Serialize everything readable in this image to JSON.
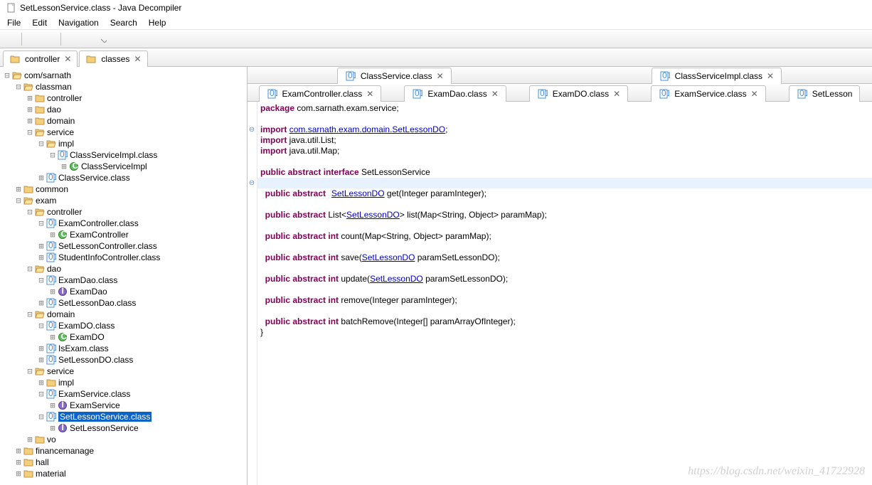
{
  "window": {
    "title": "SetLessonService.class - Java Decompiler"
  },
  "menu": {
    "file": "File",
    "edit": "Edit",
    "navigation": "Navigation",
    "search": "Search",
    "help": "Help"
  },
  "folderTabs": [
    {
      "label": "controller",
      "close": "✕"
    },
    {
      "label": "classes",
      "close": "✕"
    }
  ],
  "tree": {
    "root": {
      "l": "com/sarnath"
    },
    "n1": {
      "l": "classman"
    },
    "n1a": {
      "l": "controller"
    },
    "n1b": {
      "l": "dao"
    },
    "n1c": {
      "l": "domain"
    },
    "n1d": {
      "l": "service"
    },
    "n1d1": {
      "l": "impl"
    },
    "n1d1a": {
      "l": "ClassServiceImpl.class"
    },
    "n1d1a1": {
      "l": "ClassServiceImpl"
    },
    "n1d2": {
      "l": "ClassService.class"
    },
    "n2": {
      "l": "common"
    },
    "n3": {
      "l": "exam"
    },
    "n3a": {
      "l": "controller"
    },
    "n3a1": {
      "l": "ExamController.class"
    },
    "n3a1a": {
      "l": "ExamController"
    },
    "n3a2": {
      "l": "SetLessonController.class"
    },
    "n3a3": {
      "l": "StudentInfoController.class"
    },
    "n3b": {
      "l": "dao"
    },
    "n3b1": {
      "l": "ExamDao.class"
    },
    "n3b1a": {
      "l": "ExamDao"
    },
    "n3b2": {
      "l": "SetLessonDao.class"
    },
    "n3c": {
      "l": "domain"
    },
    "n3c1": {
      "l": "ExamDO.class"
    },
    "n3c1a": {
      "l": "ExamDO"
    },
    "n3c2": {
      "l": "IsExam.class"
    },
    "n3c3": {
      "l": "SetLessonDO.class"
    },
    "n3d": {
      "l": "service"
    },
    "n3d1": {
      "l": "impl"
    },
    "n3d2": {
      "l": "ExamService.class"
    },
    "n3d2a": {
      "l": "ExamService"
    },
    "n3d3": {
      "l": "SetLessonService.class"
    },
    "n3d3a": {
      "l": "SetLessonService"
    },
    "n3e": {
      "l": "vo"
    },
    "n4": {
      "l": "financemanage"
    },
    "n5": {
      "l": "hall"
    },
    "n6": {
      "l": "material"
    }
  },
  "editorTabs": {
    "row1": [
      {
        "label": "ClassService.class",
        "close": "✕"
      },
      {
        "label": "ClassServiceImpl.class",
        "close": "✕"
      }
    ],
    "row2": [
      {
        "label": "ExamController.class",
        "close": "✕"
      },
      {
        "label": "ExamDao.class",
        "close": "✕"
      },
      {
        "label": "ExamDO.class",
        "close": "✕"
      },
      {
        "label": "ExamService.class",
        "close": "✕"
      },
      {
        "label": "SetLesson",
        "close": ""
      }
    ]
  },
  "code": {
    "l1a": "package",
    "l1b": " com.sarnath.exam.service;",
    "l3a": "import",
    "l3b": " ",
    "l3c": "com.sarnath.exam.domain.SetLessonDO",
    "l3d": ";",
    "l4a": "import",
    "l4b": " java.util.List;",
    "l5a": "import",
    "l5b": " java.util.Map;",
    "l7a": "public abstract interface",
    "l7b": " SetLessonService",
    "l8": "{",
    "l9a": "  public abstract",
    "l9b_link": "SetLessonDO",
    "l9c": " get(Integer paramInteger);",
    "l11a": "  public abstract",
    "l11b": " List<",
    "l11c_link": "SetLessonDO",
    "l11d": "> list(Map<String, Object> paramMap);",
    "l13a": "  public abstract int",
    "l13b": " count(Map<String, Object> paramMap);",
    "l15a": "  public abstract int",
    "l15b": " save(",
    "l15c_link": "SetLessonDO",
    "l15d": " paramSetLessonDO);",
    "l17a": "  public abstract int",
    "l17b": " update(",
    "l17c_link": "SetLessonDO",
    "l17d": " paramSetLessonDO);",
    "l19a": "  public abstract int",
    "l19b": " remove(Integer paramInteger);",
    "l21a": "  public abstract int",
    "l21b": " batchRemove(Integer[] paramArrayOfInteger);",
    "l22": "}"
  },
  "watermark": "https://blog.csdn.net/weixin_41722928"
}
